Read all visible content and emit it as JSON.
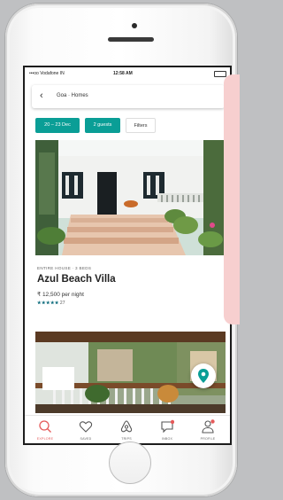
{
  "status_bar": {
    "carrier": "•••oo Vodafone IN",
    "time": "12:58 AM"
  },
  "search": {
    "back_icon": "chevron-left-icon",
    "query": "Goa · Homes"
  },
  "filters": {
    "dates": "20 – 23 Dec",
    "guests": "2 guests",
    "filters": "Filters"
  },
  "listing": {
    "type": "ENTIRE HOUSE · 3 BEDS",
    "title": "Azul Beach Villa",
    "price": "₹ 12,500 per night",
    "stars": "★★★★★",
    "review_count": "27"
  },
  "tabs": [
    {
      "label": "EXPLORE",
      "icon": "search-icon",
      "active": true
    },
    {
      "label": "SAVED",
      "icon": "heart-icon"
    },
    {
      "label": "TRIPS",
      "icon": "airbnb-logo-icon"
    },
    {
      "label": "INBOX",
      "icon": "chat-icon"
    },
    {
      "label": "PROFILE",
      "icon": "user-icon"
    }
  ],
  "colors": {
    "accent_teal": "#0a9e96",
    "active_tab": "#e55a5a",
    "notification": "#e55a5a",
    "overlay_pink": "#f7cfcf"
  }
}
